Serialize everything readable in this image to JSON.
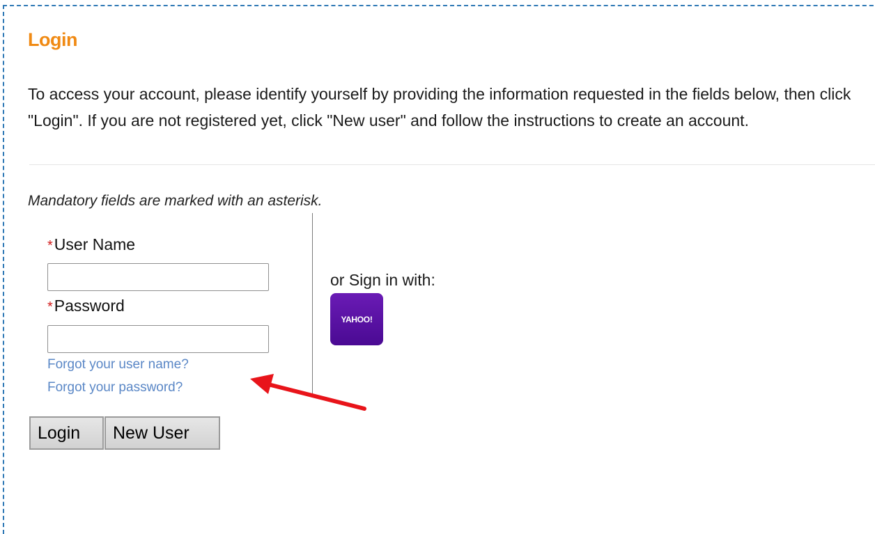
{
  "page": {
    "title": "Login",
    "intro": "To access your account, please identify yourself by providing the information requested in the fields below, then click \"Login\". If you are not registered yet, click \"New user\" and follow the instructions to create an account.",
    "mandatory_note": "Mandatory fields are marked with an asterisk."
  },
  "form": {
    "asterisk": "*",
    "username_label": "User Name",
    "username_value": "",
    "password_label": "Password",
    "password_value": "",
    "forgot_username": "Forgot your user name?",
    "forgot_password": "Forgot your password?",
    "login_button": "Login",
    "new_user_button": "New User"
  },
  "alt_signin": {
    "label": "or Sign in with:",
    "yahoo_label": "YAHOO!"
  },
  "colors": {
    "title": "#f08a14",
    "link": "#5a87c6",
    "asterisk": "#d11a1a",
    "yahoo": "#5b11a6",
    "annotation_arrow": "#e8141a",
    "frame_border": "#2e78b5"
  },
  "icons": {
    "annotation": "red-arrow-icon"
  }
}
